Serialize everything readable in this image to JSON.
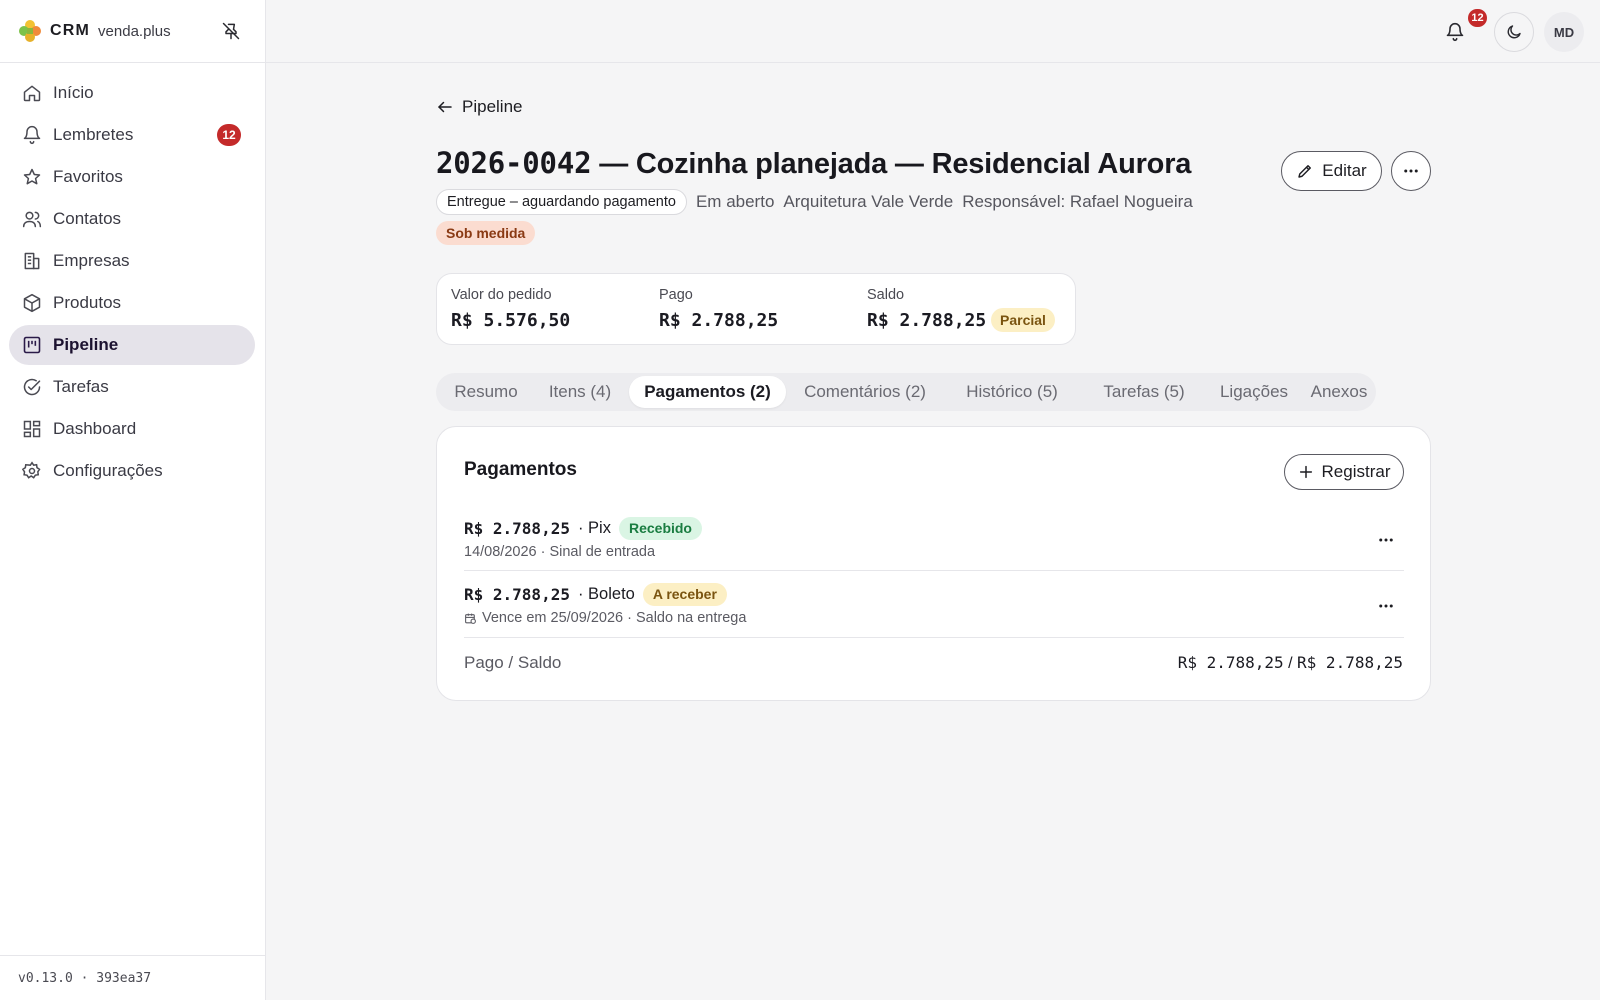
{
  "brand": {
    "crm": "CRM",
    "name": "venda.plus"
  },
  "sidebar": {
    "items": [
      {
        "label": "Início",
        "icon": "home-icon"
      },
      {
        "label": "Lembretes",
        "icon": "bell-icon",
        "badge": "12"
      },
      {
        "label": "Favoritos",
        "icon": "star-icon"
      },
      {
        "label": "Contatos",
        "icon": "users-icon"
      },
      {
        "label": "Empresas",
        "icon": "building-icon"
      },
      {
        "label": "Produtos",
        "icon": "package-icon"
      },
      {
        "label": "Pipeline",
        "icon": "kanban-icon",
        "active": true
      },
      {
        "label": "Tarefas",
        "icon": "check-circle-icon"
      },
      {
        "label": "Dashboard",
        "icon": "dashboard-icon"
      },
      {
        "label": "Configurações",
        "icon": "gear-icon"
      }
    ],
    "version": "v0.13.0 · 393ea37"
  },
  "topbar": {
    "notification_count": "12",
    "avatar_initials": "MD"
  },
  "page": {
    "back_label": "Pipeline",
    "title_code": "2026-0042",
    "title_rest": " — Cozinha planejada — Residencial Aurora",
    "edit_label": "Editar",
    "status": "Entregue – aguardando pagamento",
    "state": "Em aberto",
    "company": "Arquitetura Vale Verde",
    "owner": "Responsável: Rafael Nogueira",
    "tag": "Sob medida"
  },
  "summary": {
    "order_label": "Valor do pedido",
    "order_value": "R$ 5.576,50",
    "paid_label": "Pago",
    "paid_value": "R$ 2.788,25",
    "balance_label": "Saldo",
    "balance_value": "R$ 2.788,25",
    "balance_badge": "Parcial"
  },
  "tabs": [
    {
      "label": "Resumo"
    },
    {
      "label": "Itens (4)"
    },
    {
      "label": "Pagamentos (2)",
      "active": true
    },
    {
      "label": "Comentários (2)"
    },
    {
      "label": "Histórico (5)"
    },
    {
      "label": "Tarefas (5)"
    },
    {
      "label": "Ligações"
    },
    {
      "label": "Anexos"
    }
  ],
  "payments": {
    "title": "Pagamentos",
    "register_label": "Registrar",
    "rows": [
      {
        "amount": "R$ 2.788,25",
        "method": "· Pix",
        "status": "Recebido",
        "detail": "14/08/2026 · Sinal de entrada"
      },
      {
        "amount": "R$ 2.788,25",
        "method": "· Boleto",
        "status": "A receber",
        "detail": "Vence em 25/09/2026 · Saldo na entrega"
      }
    ],
    "footer_label": "Pago / Saldo",
    "footer_paid": "R$ 2.788,25",
    "footer_sep": " / ",
    "footer_balance": "R$ 2.788,25"
  },
  "colors": {
    "accent_active_nav": "#e5e3ea",
    "badge_red": "#c42a2a",
    "status_green": "#1a7d41",
    "status_yellow": "#7a5410",
    "tag_orange": "#8a3a14"
  }
}
